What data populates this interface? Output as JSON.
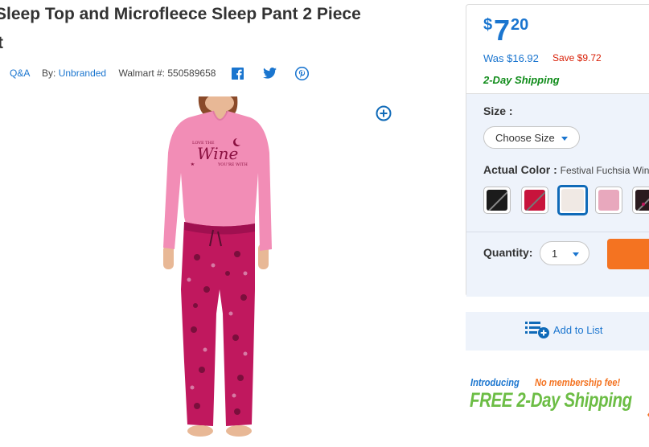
{
  "product": {
    "title_line1": "Sleep Top and Microfleece Sleep Pant 2 Piece",
    "title_line2": "t"
  },
  "meta": {
    "qa_link": "Q&A",
    "by_label": "By:",
    "brand": "Unbranded",
    "walmart_label": "Walmart #:",
    "walmart_number": "550589658",
    "social_icons": [
      "facebook-icon",
      "twitter-icon",
      "pinterest-icon"
    ]
  },
  "image": {
    "shirt_text_top": "LOVE THE",
    "shirt_text_main": "Wine",
    "shirt_text_bottom": "YOU'RE WITH"
  },
  "pricing": {
    "currency": "$",
    "whole": "7",
    "cents": "20",
    "was": "Was $16.92",
    "save": "Save $9.72",
    "shipping": "2-Day Shipping"
  },
  "options": {
    "size_label": "Size :",
    "size_placeholder": "Choose Size",
    "color_label": "Actual Color :",
    "color_value": "Festival Fuchsia Win",
    "swatches": [
      {
        "color": "#1b1b1b",
        "state": "unavailable"
      },
      {
        "color": "#c8143c",
        "state": "unavailable"
      },
      {
        "color": "#f0e9e4",
        "state": "selected"
      },
      {
        "color": "#e8a8bd",
        "state": "available"
      },
      {
        "color": "#2a1a1e",
        "state": "unavailable"
      }
    ],
    "quantity_label": "Quantity:",
    "quantity_value": "1"
  },
  "actions": {
    "add_to_list": "Add to List"
  },
  "promo": {
    "introducing": "Introducing",
    "no_membership": "No membership fee!",
    "free_shipping": "FREE 2-Day Shipping"
  },
  "colors": {
    "link_blue": "#1a75cf",
    "save_red": "#d81e05",
    "shipping_green": "#108c1a",
    "cart_orange": "#f47321",
    "promo_green": "#6cbd45"
  }
}
